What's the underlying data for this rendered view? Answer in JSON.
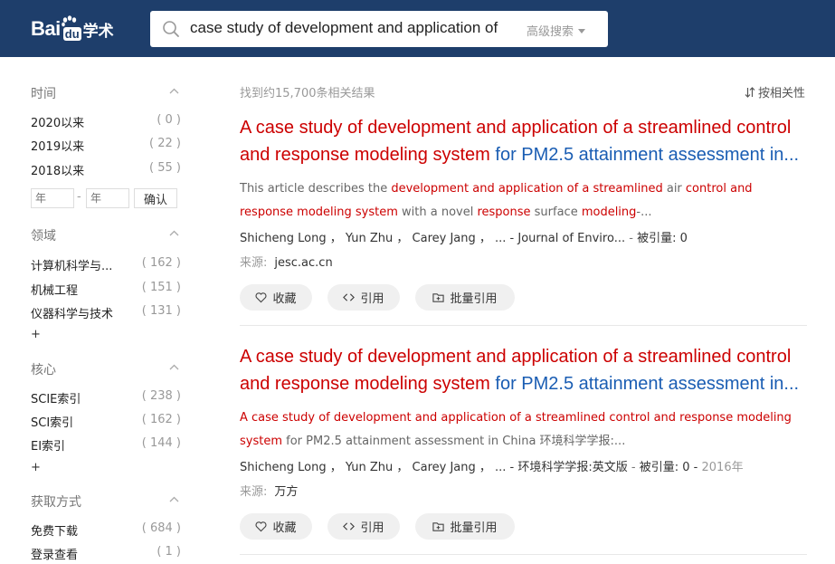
{
  "header": {
    "logo": {
      "bai": "Bai",
      "du": "du",
      "xueshu": "学术"
    },
    "search": {
      "query": "case study of development and application of",
      "advanced_label": "高级搜索"
    }
  },
  "sidebar": {
    "sections": [
      {
        "title": "时间",
        "items": [
          {
            "label": "2020以来",
            "count": "( 0 )"
          },
          {
            "label": "2019以来",
            "count": "( 22 )"
          },
          {
            "label": "2018以来",
            "count": "( 55 )"
          }
        ]
      },
      {
        "title": "领域",
        "items": [
          {
            "label": "计算机科学与...",
            "count": "( 162 )"
          },
          {
            "label": "机械工程",
            "count": "( 151 )"
          },
          {
            "label": "仪器科学与技术",
            "count": "( 131 )"
          }
        ]
      },
      {
        "title": "核心",
        "items": [
          {
            "label": "SCIE索引",
            "count": "( 238 )"
          },
          {
            "label": "SCI索引",
            "count": "( 162 )"
          },
          {
            "label": "EI索引",
            "count": "( 144 )"
          }
        ]
      },
      {
        "title": "获取方式",
        "items": [
          {
            "label": "免费下载",
            "count": "( 684 )"
          },
          {
            "label": "登录查看",
            "count": "( 1 )"
          }
        ]
      }
    ],
    "year_filter": {
      "from_placeholder": "年",
      "to_placeholder": "年",
      "dash": "-",
      "confirm": "确认"
    },
    "more_label": "+"
  },
  "main": {
    "result_count": "找到约15,700条相关结果",
    "sort_label": "按相关性",
    "results": [
      {
        "title_hl": "A case study of development and application of a streamlined control and response modeling system",
        "title_rest": " for PM2.5 attainment assessment in...",
        "abstract_parts": [
          {
            "t": "This article describes the ",
            "hl": false
          },
          {
            "t": "development and application of a streamlined",
            "hl": true
          },
          {
            "t": " air ",
            "hl": false
          },
          {
            "t": "control and response modeling system",
            "hl": true
          },
          {
            "t": " with a novel ",
            "hl": false
          },
          {
            "t": "response",
            "hl": true
          },
          {
            "t": " surface ",
            "hl": false
          },
          {
            "t": "modeling",
            "hl": true
          },
          {
            "t": "-...",
            "hl": false
          }
        ],
        "authors": "Shicheng Long ，  Yun Zhu ，  Carey Jang ，  ... - ",
        "journal": "Journal of Enviro...",
        "cite_sep": "  -  ",
        "cited": "被引量:  0",
        "year": "",
        "source_label": "来源:",
        "source": "jesc.ac.cn"
      },
      {
        "title_hl": "A case study of development and application of a streamlined control and response modeling system",
        "title_rest": " for PM2.5 attainment assessment in...",
        "abstract_parts": [
          {
            "t": "A case study of development and application of a streamlined control and response modeling system",
            "hl": true
          },
          {
            "t": " for PM2.5 attainment assessment in China 环境科学学报:...",
            "hl": false
          }
        ],
        "authors": "Shicheng Long ，  Yun Zhu ，  Carey Jang ，  ... - ",
        "journal": "环境科学学报:英文版",
        "cite_sep": "  -  ",
        "cited": "被引量:  0  -",
        "year": "2016年",
        "source_label": "来源:",
        "source": "万方"
      }
    ],
    "actions": {
      "favorite": "收藏",
      "cite": "引用",
      "batch_cite": "批量引用"
    }
  },
  "colors": {
    "header_bg": "#1e3e6b",
    "title_red": "#c00",
    "title_blue": "#1a5db3"
  }
}
